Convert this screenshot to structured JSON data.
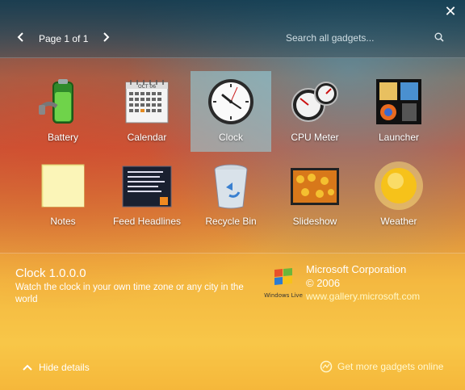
{
  "window": {
    "close_icon": "close-icon"
  },
  "nav": {
    "page_label": "Page 1 of 1",
    "prev_icon": "chevron-left-icon",
    "next_icon": "chevron-right-icon"
  },
  "search": {
    "placeholder": "Search all gadgets...",
    "icon": "search-icon"
  },
  "gadgets": [
    {
      "label": "Battery",
      "icon": "battery-icon",
      "selected": false
    },
    {
      "label": "Calendar",
      "icon": "calendar-icon",
      "selected": false
    },
    {
      "label": "Clock",
      "icon": "clock-icon",
      "selected": true
    },
    {
      "label": "CPU Meter",
      "icon": "cpu-meter-icon",
      "selected": false
    },
    {
      "label": "Launcher",
      "icon": "launcher-icon",
      "selected": false
    },
    {
      "label": "Notes",
      "icon": "notes-icon",
      "selected": false
    },
    {
      "label": "Feed Headlines",
      "icon": "feed-headlines-icon",
      "selected": false
    },
    {
      "label": "Recycle Bin",
      "icon": "recycle-bin-icon",
      "selected": false
    },
    {
      "label": "Slideshow",
      "icon": "slideshow-icon",
      "selected": false
    },
    {
      "label": "Weather",
      "icon": "weather-icon",
      "selected": false
    }
  ],
  "calendar_icon": {
    "month": "OCT 06",
    "highlight": "25"
  },
  "details": {
    "title": "Clock 1.0.0.0",
    "description": "Watch the clock in your own time zone or any city in the world",
    "logo_caption": "Windows Live",
    "publisher": "Microsoft Corporation",
    "copyright": "© 2006",
    "website": "www.gallery.microsoft.com"
  },
  "footer": {
    "hide_details_label": "Hide details",
    "more_gadgets_label": "Get more gadgets online",
    "hide_icon": "chevron-up-icon",
    "more_icon": "globe-icon"
  }
}
